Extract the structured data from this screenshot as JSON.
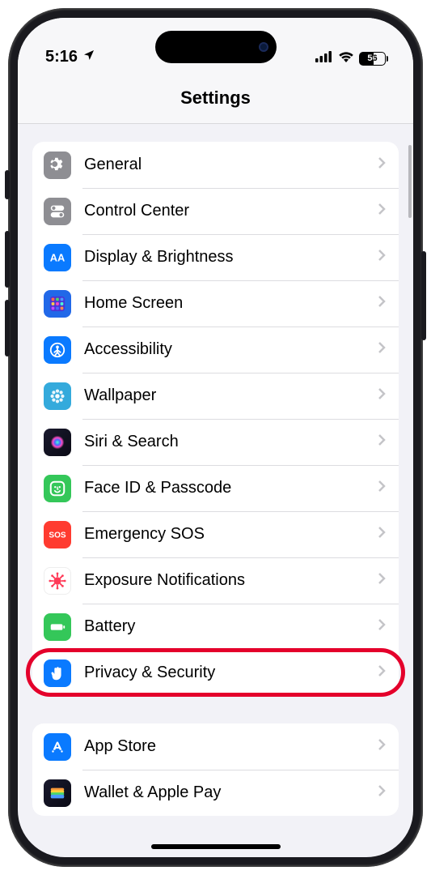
{
  "status": {
    "time": "5:16",
    "battery": "56"
  },
  "title": "Settings",
  "groups": [
    {
      "rows": [
        {
          "id": "general",
          "label": "General",
          "icon": "gear",
          "color": "c-gray"
        },
        {
          "id": "control-center",
          "label": "Control Center",
          "icon": "toggles",
          "color": "c-gray2"
        },
        {
          "id": "display",
          "label": "Display & Brightness",
          "icon": "aa",
          "color": "c-blue"
        },
        {
          "id": "home-screen",
          "label": "Home Screen",
          "icon": "grid",
          "color": "c-multi"
        },
        {
          "id": "accessibility",
          "label": "Accessibility",
          "icon": "person",
          "color": "c-blue"
        },
        {
          "id": "wallpaper",
          "label": "Wallpaper",
          "icon": "flower",
          "color": "c-wall"
        },
        {
          "id": "siri",
          "label": "Siri & Search",
          "icon": "siri",
          "color": "c-dark"
        },
        {
          "id": "faceid",
          "label": "Face ID & Passcode",
          "icon": "face",
          "color": "c-green"
        },
        {
          "id": "sos",
          "label": "Emergency SOS",
          "icon": "sos",
          "color": "c-red"
        },
        {
          "id": "exposure",
          "label": "Exposure Notifications",
          "icon": "covid",
          "color": "c-white"
        },
        {
          "id": "battery",
          "label": "Battery",
          "icon": "batt",
          "color": "c-green"
        },
        {
          "id": "privacy",
          "label": "Privacy & Security",
          "icon": "hand",
          "color": "c-blue",
          "highlight": true
        }
      ]
    },
    {
      "rows": [
        {
          "id": "appstore",
          "label": "App Store",
          "icon": "astore",
          "color": "c-blue"
        },
        {
          "id": "wallet",
          "label": "Wallet & Apple Pay",
          "icon": "wallet",
          "color": "c-dark"
        }
      ]
    }
  ]
}
